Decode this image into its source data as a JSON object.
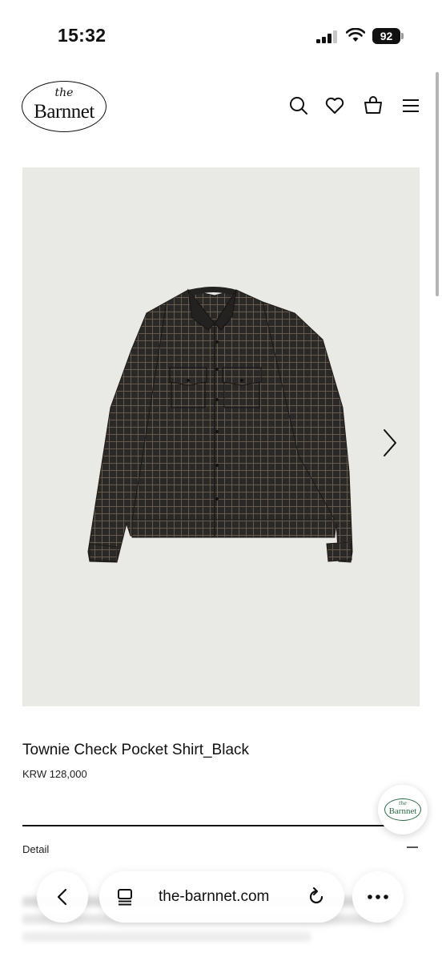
{
  "status_bar": {
    "time": "15:32",
    "battery_level": "92",
    "icons": [
      "signal-icon",
      "wifi-icon",
      "battery-icon"
    ]
  },
  "header": {
    "logo_the": "the",
    "logo_name": "Barnnet",
    "icons": [
      "search-icon",
      "heart-icon",
      "shopping-bag-icon",
      "menu-icon"
    ]
  },
  "product": {
    "image_icon": "chevron-right-icon",
    "name": "Townie Check Pocket Shirt_Black",
    "price": "KRW 128,000",
    "detail_label": "Detail",
    "detail_toggle_icon": "minus-icon"
  },
  "float_badge": {
    "the": "the",
    "name": "Barnnet"
  },
  "browser": {
    "url": "the-barnnet.com",
    "icons": [
      "back-icon",
      "tabs-icon",
      "reload-icon",
      "more-icon"
    ]
  },
  "colors": {
    "image_bg": "#e9e9e6",
    "shirt": "#2b2927",
    "badge_green": "#2d6a45"
  }
}
